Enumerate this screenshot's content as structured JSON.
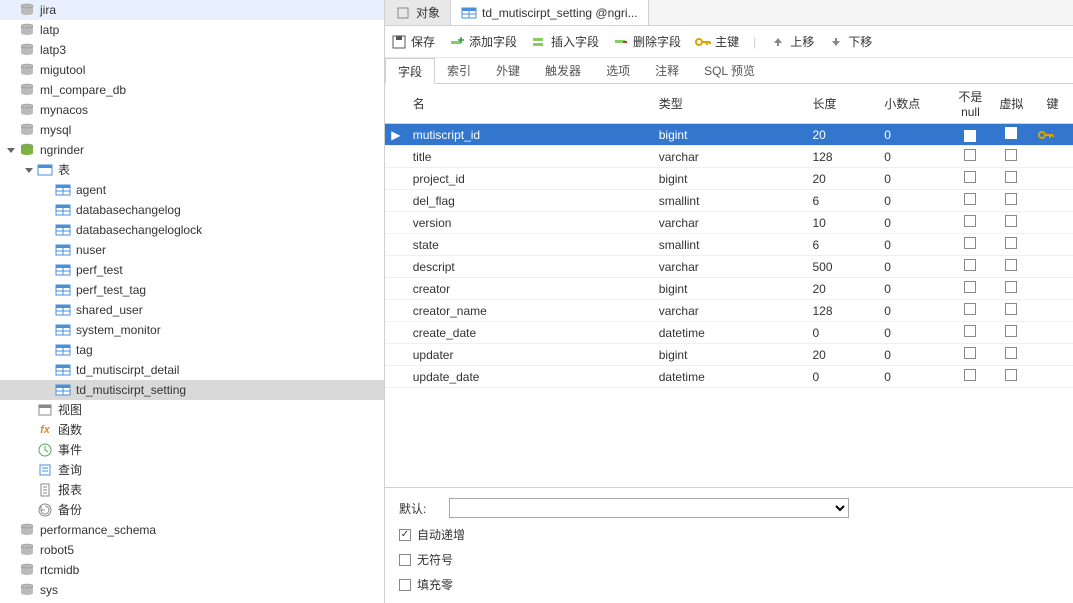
{
  "sidebar": {
    "databases": [
      {
        "label": "jira",
        "type": "db"
      },
      {
        "label": "latp",
        "type": "db"
      },
      {
        "label": "latp3",
        "type": "db"
      },
      {
        "label": "migutool",
        "type": "db"
      },
      {
        "label": "ml_compare_db",
        "type": "db"
      },
      {
        "label": "mynacos",
        "type": "db"
      },
      {
        "label": "mysql",
        "type": "db"
      },
      {
        "label": "ngrinder",
        "type": "db",
        "open": true,
        "expanded": true,
        "children": [
          {
            "label": "表",
            "type": "folder-tables",
            "expanded": true,
            "children": [
              {
                "label": "agent",
                "type": "table"
              },
              {
                "label": "databasechangelog",
                "type": "table"
              },
              {
                "label": "databasechangeloglock",
                "type": "table"
              },
              {
                "label": "nuser",
                "type": "table"
              },
              {
                "label": "perf_test",
                "type": "table"
              },
              {
                "label": "perf_test_tag",
                "type": "table"
              },
              {
                "label": "shared_user",
                "type": "table"
              },
              {
                "label": "system_monitor",
                "type": "table"
              },
              {
                "label": "tag",
                "type": "table"
              },
              {
                "label": "td_mutiscirpt_detail",
                "type": "table"
              },
              {
                "label": "td_mutiscirpt_setting",
                "type": "table",
                "selected": true
              }
            ]
          },
          {
            "label": "视图",
            "type": "folder-views"
          },
          {
            "label": "函数",
            "type": "folder-functions"
          },
          {
            "label": "事件",
            "type": "folder-events"
          },
          {
            "label": "查询",
            "type": "folder-queries"
          },
          {
            "label": "报表",
            "type": "folder-reports"
          },
          {
            "label": "备份",
            "type": "folder-backup"
          }
        ]
      },
      {
        "label": "performance_schema",
        "type": "db"
      },
      {
        "label": "robot5",
        "type": "db"
      },
      {
        "label": "rtcmidb",
        "type": "db"
      },
      {
        "label": "sys",
        "type": "db"
      }
    ],
    "more": "..."
  },
  "tabs": [
    {
      "label": "对象",
      "icon": "object",
      "active": false
    },
    {
      "label": "td_mutiscirpt_setting @ngri...",
      "icon": "table",
      "active": true
    }
  ],
  "toolbar": {
    "save": "保存",
    "add_field": "添加字段",
    "insert_field": "插入字段",
    "delete_field": "删除字段",
    "primary_key": "主键",
    "move_up": "上移",
    "move_down": "下移"
  },
  "subtabs": [
    "字段",
    "索引",
    "外键",
    "触发器",
    "选项",
    "注释",
    "SQL 预览"
  ],
  "subtab_active": 0,
  "grid": {
    "headers": {
      "name": "名",
      "type": "类型",
      "length": "长度",
      "decimal": "小数点",
      "notnull": "不是 null",
      "virtual": "虚拟",
      "key": "键"
    },
    "rows": [
      {
        "name": "mutiscript_id",
        "type": "bigint",
        "length": "20",
        "decimal": "0",
        "notnull": true,
        "virtual": false,
        "key": true,
        "selected": true
      },
      {
        "name": "title",
        "type": "varchar",
        "length": "128",
        "decimal": "0",
        "notnull": false,
        "virtual": false
      },
      {
        "name": "project_id",
        "type": "bigint",
        "length": "20",
        "decimal": "0",
        "notnull": false,
        "virtual": false
      },
      {
        "name": "del_flag",
        "type": "smallint",
        "length": "6",
        "decimal": "0",
        "notnull": false,
        "virtual": false
      },
      {
        "name": "version",
        "type": "varchar",
        "length": "10",
        "decimal": "0",
        "notnull": false,
        "virtual": false
      },
      {
        "name": "state",
        "type": "smallint",
        "length": "6",
        "decimal": "0",
        "notnull": false,
        "virtual": false
      },
      {
        "name": "descript",
        "type": "varchar",
        "length": "500",
        "decimal": "0",
        "notnull": false,
        "virtual": false
      },
      {
        "name": "creator",
        "type": "bigint",
        "length": "20",
        "decimal": "0",
        "notnull": false,
        "virtual": false
      },
      {
        "name": "creator_name",
        "type": "varchar",
        "length": "128",
        "decimal": "0",
        "notnull": false,
        "virtual": false
      },
      {
        "name": "create_date",
        "type": "datetime",
        "length": "0",
        "decimal": "0",
        "notnull": false,
        "virtual": false
      },
      {
        "name": "updater",
        "type": "bigint",
        "length": "20",
        "decimal": "0",
        "notnull": false,
        "virtual": false
      },
      {
        "name": "update_date",
        "type": "datetime",
        "length": "0",
        "decimal": "0",
        "notnull": false,
        "virtual": false
      }
    ]
  },
  "bottom": {
    "default_label": "默认:",
    "default_value": "",
    "auto_increment": {
      "label": "自动递增",
      "checked": true
    },
    "unsigned": {
      "label": "无符号",
      "checked": false
    },
    "zerofill": {
      "label": "填充零",
      "checked": false
    }
  }
}
